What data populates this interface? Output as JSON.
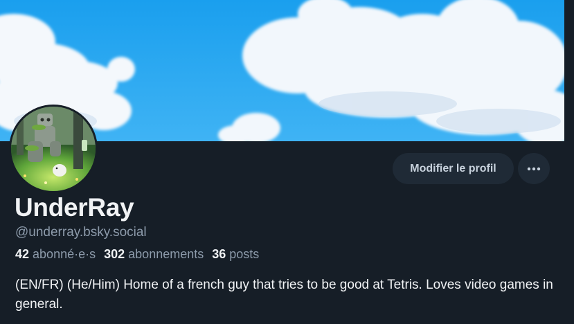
{
  "profile": {
    "display_name": "UnderRay",
    "handle": "@underray.bsky.social",
    "bio": "(EN/FR) (He/Him) Home of a french guy that tries to be good at Tetris. Loves video games in general.",
    "stats": {
      "followers_count": "42",
      "followers_label": "abonné·e·s",
      "following_count": "302",
      "following_label": "abonnements",
      "posts_count": "36",
      "posts_label": "posts"
    }
  },
  "actions": {
    "edit_profile_label": "Modifier le profil",
    "more_icon": "ellipsis-icon"
  },
  "colors": {
    "background": "#161e27",
    "button_bg": "#1f2a36",
    "muted_text": "#8d9bab",
    "primary_text": "#f1f3f5",
    "banner_sky": "#2aa8f2"
  }
}
